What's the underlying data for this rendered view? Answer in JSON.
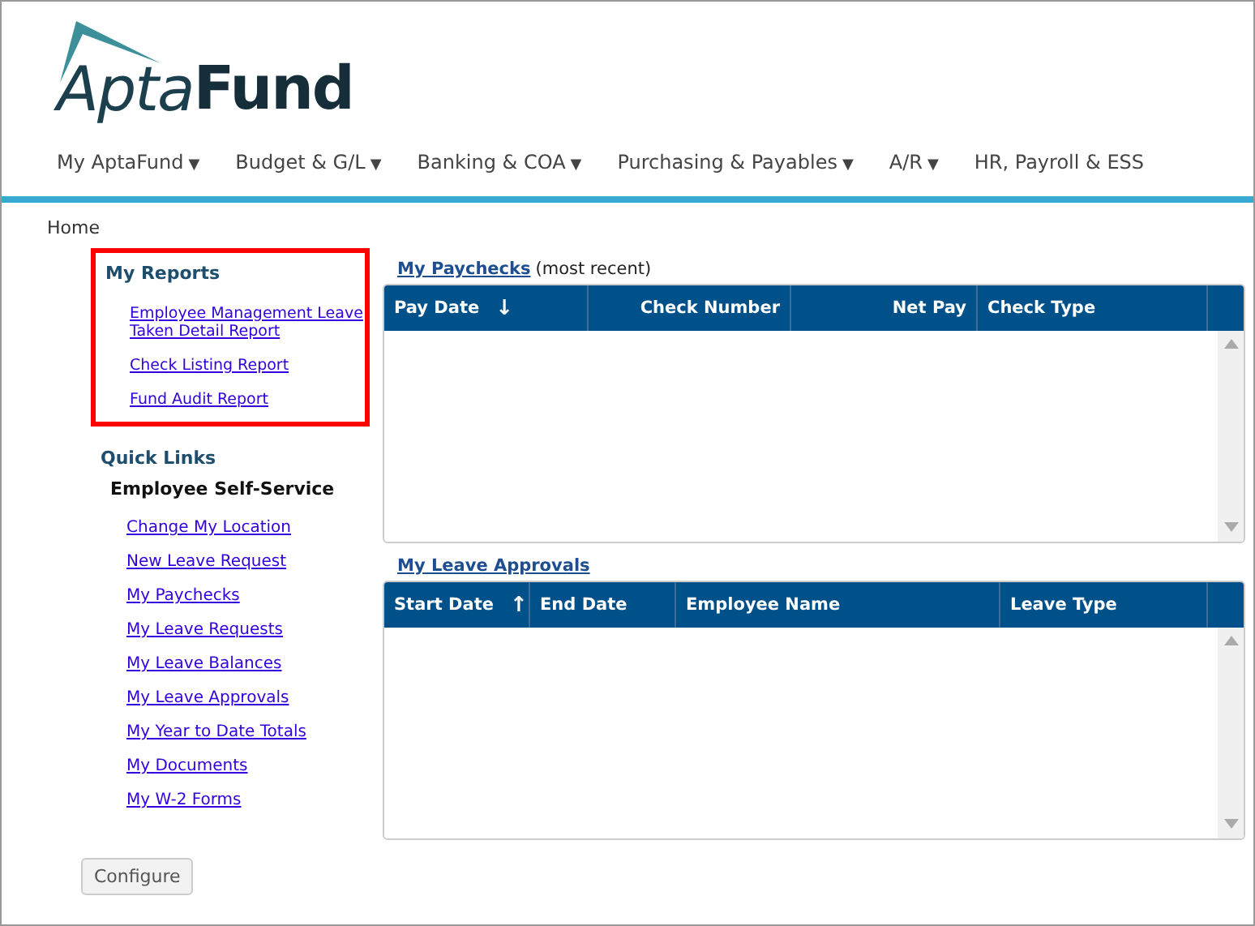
{
  "logo": {
    "part1": "Apta",
    "part2": "Fund"
  },
  "nav": [
    {
      "label": "My AptaFund",
      "caret": "▼"
    },
    {
      "label": "Budget & G/L",
      "caret": "▼"
    },
    {
      "label": "Banking & COA",
      "caret": "▼"
    },
    {
      "label": "Purchasing & Payables",
      "caret": "▼"
    },
    {
      "label": "A/R",
      "caret": "▼"
    },
    {
      "label": "HR, Payroll & ESS"
    }
  ],
  "breadcrumb": "Home",
  "my_reports": {
    "title": "My Reports",
    "highlighted": true,
    "links": [
      "Employee Management Leave Taken Detail Report",
      "Check Listing Report",
      "Fund Audit Report"
    ]
  },
  "quick_links": {
    "title": "Quick Links",
    "group": "Employee Self-Service",
    "links": [
      "Change My Location",
      "New Leave Request",
      "My Paychecks",
      "My Leave Requests",
      "My Leave Balances",
      "My Leave Approvals",
      "My Year to Date Totals",
      "My Documents",
      "My W-2 Forms"
    ]
  },
  "configure_button": "Configure",
  "panels": [
    {
      "title": "My Paychecks",
      "note": "(most recent)",
      "columns": [
        {
          "label": "Pay Date",
          "sort": "↓"
        },
        {
          "label": "Check Number"
        },
        {
          "label": "Net Pay"
        },
        {
          "label": "Check Type"
        }
      ]
    },
    {
      "title": "My Leave Approvals",
      "columns": [
        {
          "label": "Start Date",
          "sort": "↑"
        },
        {
          "label": "End Date"
        },
        {
          "label": "Employee Name"
        },
        {
          "label": "Leave Type"
        }
      ]
    }
  ]
}
